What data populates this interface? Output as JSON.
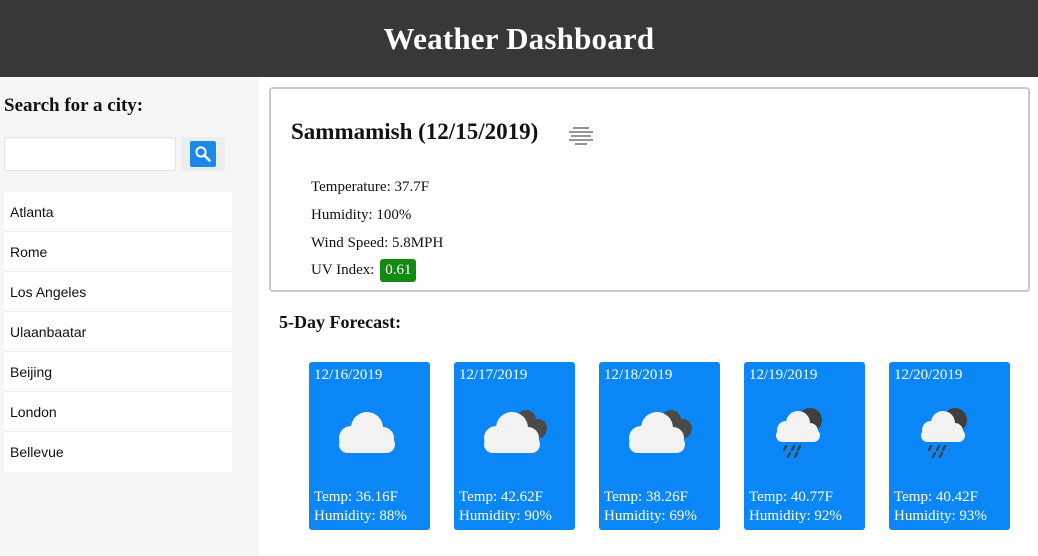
{
  "header": {
    "title": "Weather Dashboard"
  },
  "sidebar": {
    "search_title": "Search for a city:",
    "search_value": "",
    "search_placeholder": "",
    "cities": [
      "Atlanta",
      "Rome",
      "Los Angeles",
      "Ulaanbaatar",
      "Beijing",
      "London",
      "Bellevue"
    ]
  },
  "current": {
    "title": "Sammamish (12/15/2019)",
    "icon": "mist-icon",
    "temperature_label": "Temperature: 37.7F",
    "humidity_label": "Humidity: 100%",
    "wind_label": "Wind Speed: 5.8MPH",
    "uv_label": "UV Index:",
    "uv_value": "0.61"
  },
  "forecast": {
    "title": "5-Day Forecast:",
    "days": [
      {
        "date": "12/16/2019",
        "icon": "cloud-icon",
        "temp": "Temp: 36.16F",
        "humidity": "Humidity: 88%"
      },
      {
        "date": "12/17/2019",
        "icon": "broken-clouds-icon",
        "temp": "Temp: 42.62F",
        "humidity": "Humidity: 90%"
      },
      {
        "date": "12/18/2019",
        "icon": "broken-clouds-icon",
        "temp": "Temp: 38.26F",
        "humidity": "Humidity: 69%"
      },
      {
        "date": "12/19/2019",
        "icon": "rain-icon",
        "temp": "Temp: 40.77F",
        "humidity": "Humidity: 92%"
      },
      {
        "date": "12/20/2019",
        "icon": "rain-icon",
        "temp": "Temp: 40.42F",
        "humidity": "Humidity: 93%"
      }
    ]
  },
  "colors": {
    "header_bg": "#3a3837",
    "forecast_card": "#0b86f7",
    "uv_badge": "#128a12",
    "search_button": "#1a8ae6"
  }
}
